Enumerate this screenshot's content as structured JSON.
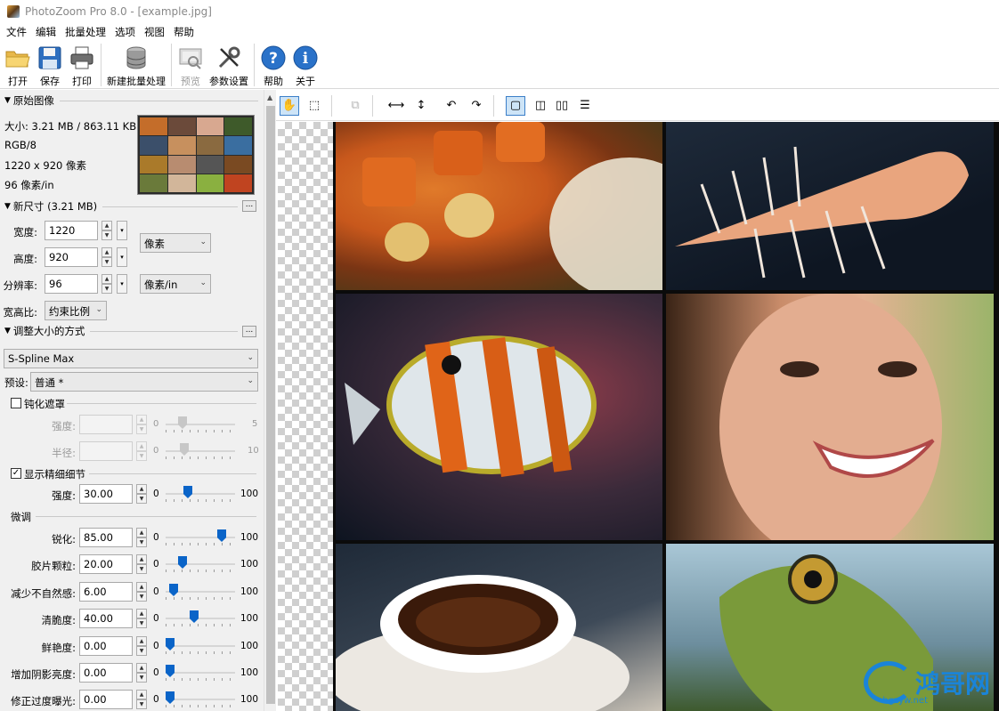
{
  "window": {
    "title": "PhotoZoom Pro 8.0 - [example.jpg]"
  },
  "menu": [
    "文件",
    "编辑",
    "批量处理",
    "选项",
    "视图",
    "帮助"
  ],
  "toolbar": {
    "open": "打开",
    "save": "保存",
    "print": "打印",
    "new_batch": "新建批量处理",
    "preview": "预览",
    "settings": "参数设置",
    "help": "帮助",
    "about": "关于"
  },
  "original": {
    "header": "原始图像",
    "size": "大小: 3.21 MB / 863.11 KB",
    "mode": "RGB/8",
    "dimensions": "1220 x 920 像素",
    "resolution": "96 像素/in"
  },
  "new_size": {
    "header": "新尺寸 (3.21 MB)",
    "width_label": "宽度:",
    "width": "1220",
    "height_label": "高度:",
    "height": "920",
    "res_label": "分辨率:",
    "res": "96",
    "unit": "像素",
    "res_unit": "像素/in",
    "aspect_label": "宽高比:",
    "aspect": "约束比例"
  },
  "resize_method": {
    "header": "调整大小的方式",
    "method": "S-Spline Max",
    "preset_label": "预设:",
    "preset": "普通 *",
    "unsharp_label": "钝化遮罩",
    "strength_label": "强度:",
    "strength_min": "0",
    "strength_max": "5",
    "radius_label": "半径:",
    "radius_min": "0",
    "radius_max": "10",
    "fine_detail_label": "显示精细细节",
    "fd_strength_label": "强度:",
    "fd_strength": "30.00",
    "fd_min": "0",
    "fd_max": "100",
    "fd_level": 0.3
  },
  "fine_tune": {
    "header": "微调",
    "items": [
      {
        "label": "锐化:",
        "value": "85.00",
        "min": "0",
        "max": "100",
        "level": 0.85
      },
      {
        "label": "胶片颗粒:",
        "value": "20.00",
        "min": "0",
        "max": "100",
        "level": 0.2
      },
      {
        "label": "减少不自然感:",
        "value": "6.00",
        "min": "0",
        "max": "100",
        "level": 0.06
      },
      {
        "label": "清脆度:",
        "value": "40.00",
        "min": "0",
        "max": "100",
        "level": 0.4
      },
      {
        "label": "鲜艳度:",
        "value": "0.00",
        "min": "0",
        "max": "100",
        "level": 0.0
      },
      {
        "label": "增加阴影亮度:",
        "value": "0.00",
        "min": "0",
        "max": "100",
        "level": 0.0
      },
      {
        "label": "修正过度曝光:",
        "value": "0.00",
        "min": "0",
        "max": "100",
        "level": 0.0
      }
    ]
  },
  "watermark": {
    "text": "鸿哥网",
    "url": "hgzyw.net"
  },
  "colors": {
    "accent": "#0a64c8",
    "watermark": "#1a84d8"
  }
}
